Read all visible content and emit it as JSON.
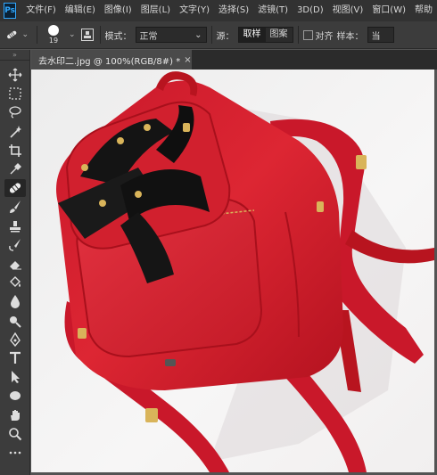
{
  "app": {
    "logo": "Ps"
  },
  "menu": [
    "文件(F)",
    "编辑(E)",
    "图像(I)",
    "图层(L)",
    "文字(Y)",
    "选择(S)",
    "滤镜(T)",
    "3D(D)",
    "视图(V)",
    "窗口(W)",
    "帮助"
  ],
  "options": {
    "tool_icon": "healing-brush-icon",
    "brush_size": "19",
    "mode_label": "模式：",
    "mode_value": "正常",
    "source_label": "源：",
    "source_sample": "取样",
    "source_pattern": "图案",
    "aligned_label": "对齐",
    "aligned_checked": false,
    "sample_label": "样本：",
    "sample_value": "当"
  },
  "tab": {
    "title": "去水印二.jpg @ 100%(RGB/8#) *",
    "close": "×"
  },
  "tools": [
    "move-icon",
    "marquee-icon",
    "lasso-icon",
    "magic-wand-icon",
    "crop-icon",
    "eyedropper-icon",
    "healing-brush-icon",
    "brush-icon",
    "clone-stamp-icon",
    "history-brush-icon",
    "eraser-icon",
    "paint-bucket-icon",
    "blur-icon",
    "dodge-icon",
    "pen-icon",
    "type-icon",
    "path-selection-icon",
    "ellipse-icon",
    "hand-icon",
    "zoom-icon",
    "more-tools-icon"
  ],
  "colors": {
    "accent": "#31a8ff",
    "bag_red": "#d21f2b",
    "bag_dark": "#a3121d",
    "ribbon": "#111111",
    "photo_bg": "#f4f2f3"
  }
}
